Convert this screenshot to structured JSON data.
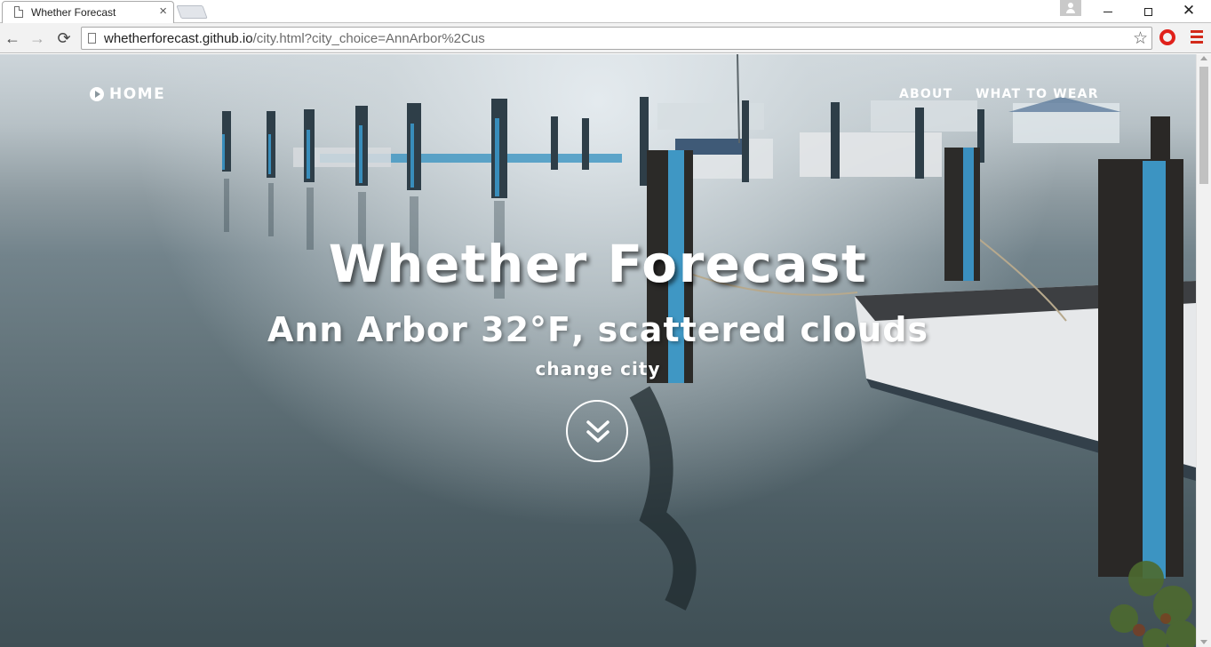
{
  "browser": {
    "tab_title": "Whether Forecast",
    "tab_close": "×",
    "url_host": "whetherforecast.github.io",
    "url_path": "/city.html?city_choice=AnnArbor%2Cus",
    "back_icon": "←",
    "forward_icon": "→",
    "reload_icon": "⟳",
    "bookmark_icon": "☆",
    "window_close": "✕"
  },
  "site": {
    "nav": {
      "home_label": "HOME",
      "about_label": "ABOUT",
      "wear_label": "WHAT TO WEAR"
    },
    "hero": {
      "title": "Whether Forecast",
      "city": "Ann Arbor",
      "temperature": "32°F",
      "conditions": "scattered clouds",
      "change_city": "change city"
    }
  },
  "colors": {
    "text": "#ffffff",
    "opera_red": "#e0211b",
    "menu_red": "#d32a1a"
  }
}
